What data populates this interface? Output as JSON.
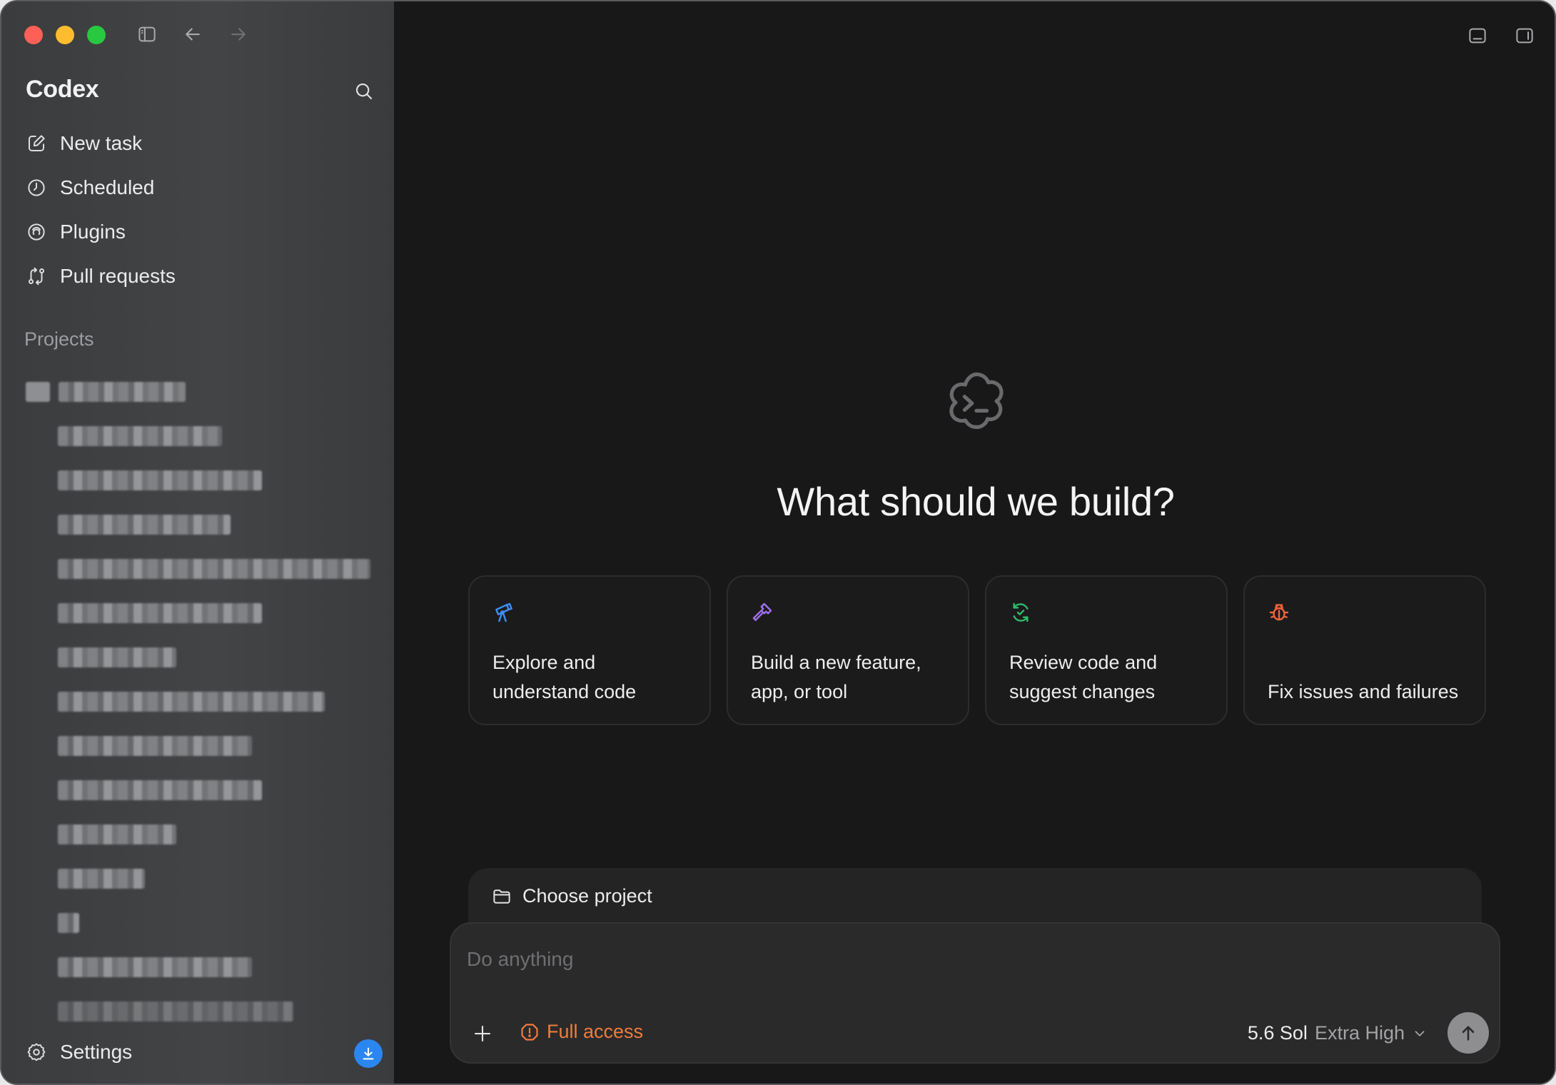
{
  "app": {
    "title": "Codex"
  },
  "sidebar": {
    "nav": [
      {
        "label": "New task",
        "icon": "edit-icon"
      },
      {
        "label": "Scheduled",
        "icon": "clock-icon"
      },
      {
        "label": "Plugins",
        "icon": "plugins-icon"
      },
      {
        "label": "Pull requests",
        "icon": "pull-request-icon"
      }
    ],
    "section_label": "Projects",
    "settings_label": "Settings"
  },
  "main": {
    "headline": "What should we build?",
    "cards": [
      {
        "label": "Explore and understand code",
        "icon": "telescope-icon",
        "color": "#3d8ef7"
      },
      {
        "label": "Build a new feature, app, or tool",
        "icon": "hammer-icon",
        "color": "#a071f0"
      },
      {
        "label": "Review code and suggest changes",
        "icon": "review-icon",
        "color": "#2fbd6b"
      },
      {
        "label": "Fix issues and failures",
        "icon": "bug-icon",
        "color": "#f0643a"
      }
    ],
    "project_picker": "Choose project",
    "composer": {
      "placeholder": "Do anything",
      "access_label": "Full access",
      "model_name": "5.6 Sol",
      "model_level": "Extra High"
    }
  },
  "colors": {
    "accent_orange": "#f07c3a",
    "badge_blue": "#2b87f0",
    "background": "#181818"
  }
}
